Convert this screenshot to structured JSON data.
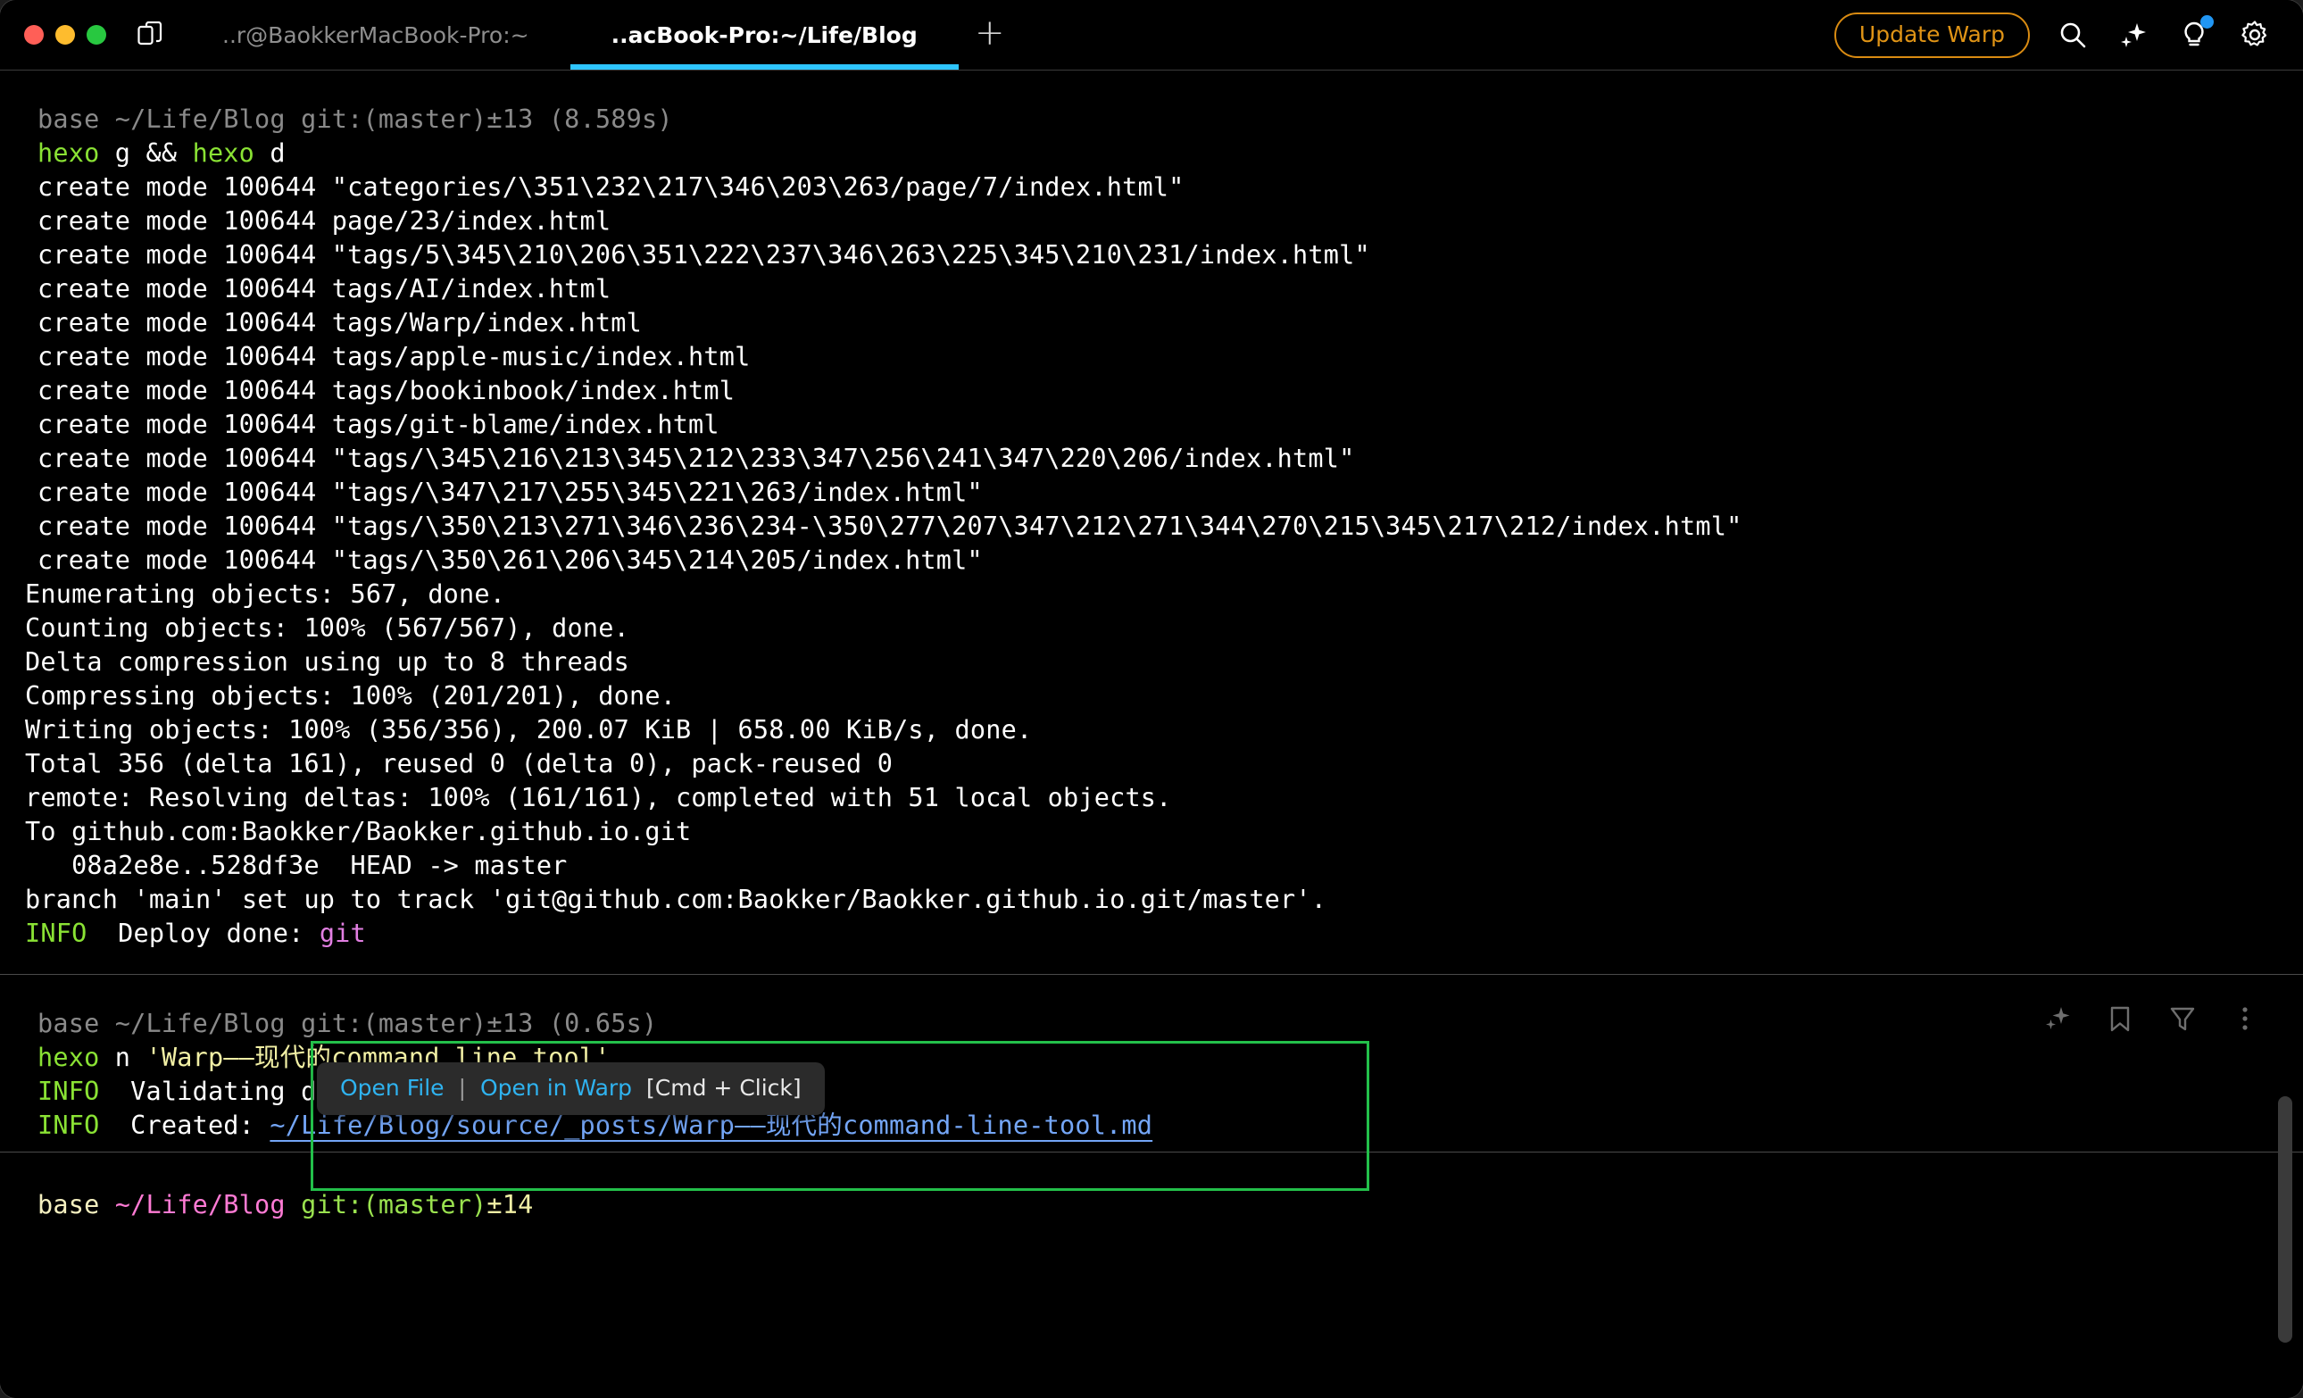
{
  "window": {
    "traffic_lights": [
      "close",
      "minimize",
      "zoom"
    ],
    "split_pane_icon": "split-pane-icon"
  },
  "tabs": [
    {
      "label": "..r@BaokkerMacBook-Pro:~",
      "active": false
    },
    {
      "label": "..acBook-Pro:~/Life/Blog",
      "active": true
    }
  ],
  "new_tab_label": "+",
  "toolbar": {
    "update_label": "Update Warp",
    "icons": [
      "search-icon",
      "sparkle-icon",
      "lightbulb-icon",
      "gear-icon"
    ],
    "accent_orange": "#e09416",
    "badge_color": "#2196f3",
    "active_tab_underline": "#2ec5ff"
  },
  "block1": {
    "prompt": "base ~/Life/Blog git:(master)±13 (8.589s)",
    "command": {
      "cmd1": "hexo",
      "arg1": " g && ",
      "cmd2": "hexo",
      "arg2": " d"
    },
    "output": [
      "create mode 100644 \"categories/\\351\\232\\217\\346\\203\\263/page/7/index.html\"",
      "create mode 100644 page/23/index.html",
      "create mode 100644 \"tags/5\\345\\210\\206\\351\\222\\237\\346\\263\\225\\345\\210\\231/index.html\"",
      "create mode 100644 tags/AI/index.html",
      "create mode 100644 tags/Warp/index.html",
      "create mode 100644 tags/apple-music/index.html",
      "create mode 100644 tags/bookinbook/index.html",
      "create mode 100644 tags/git-blame/index.html",
      "create mode 100644 \"tags/\\345\\216\\213\\345\\212\\233\\347\\256\\241\\347\\220\\206/index.html\"",
      "create mode 100644 \"tags/\\347\\217\\255\\345\\221\\263/index.html\"",
      "create mode 100644 \"tags/\\350\\213\\271\\346\\236\\234-\\350\\277\\207\\347\\212\\271\\344\\270\\215\\345\\217\\212/index.html\"",
      "create mode 100644 \"tags/\\350\\261\\206\\345\\214\\205/index.html\"",
      "Enumerating objects: 567, done.",
      "Counting objects: 100% (567/567), done.",
      "Delta compression using up to 8 threads",
      "Compressing objects: 100% (201/201), done.",
      "Writing objects: 100% (356/356), 200.07 KiB | 658.00 KiB/s, done.",
      "Total 356 (delta 161), reused 0 (delta 0), pack-reused 0",
      "remote: Resolving deltas: 100% (161/161), completed with 51 local objects.",
      "To github.com:Baokker/Baokker.github.io.git",
      "   08a2e8e..528df3e  HEAD -> master",
      "branch 'main' set up to track 'git@github.com:Baokker/Baokker.github.io.git/master'."
    ],
    "deploy": {
      "tag": "INFO",
      "text": "  Deploy done: ",
      "value": "git"
    }
  },
  "block2": {
    "prompt": "base ~/Life/Blog git:(master)±13 (0.65s)",
    "icons": [
      "sparkle-icon",
      "bookmark-icon",
      "filter-icon",
      "more-options-icon"
    ],
    "command": {
      "cmd": "hexo",
      "sub": " n ",
      "arg": "'Warp——现代的command line tool'"
    },
    "info_validating": {
      "tag": "INFO",
      "text": "  Validating data"
    },
    "info_created": {
      "tag": "INFO",
      "text": "  Created: ",
      "path": "~/Life/Blog/source/_posts/Warp——现代的command-line-tool.md"
    },
    "tooltip": {
      "open_file": "Open File",
      "divider": "|",
      "open_in_warp": "Open in Warp",
      "shortcut": "[Cmd + Click]"
    },
    "selection_border_color": "#23c04a"
  },
  "final_prompt": {
    "base": "base ",
    "path": "~/Life/Blog",
    "git": " git:(master)",
    "count": "±14"
  }
}
